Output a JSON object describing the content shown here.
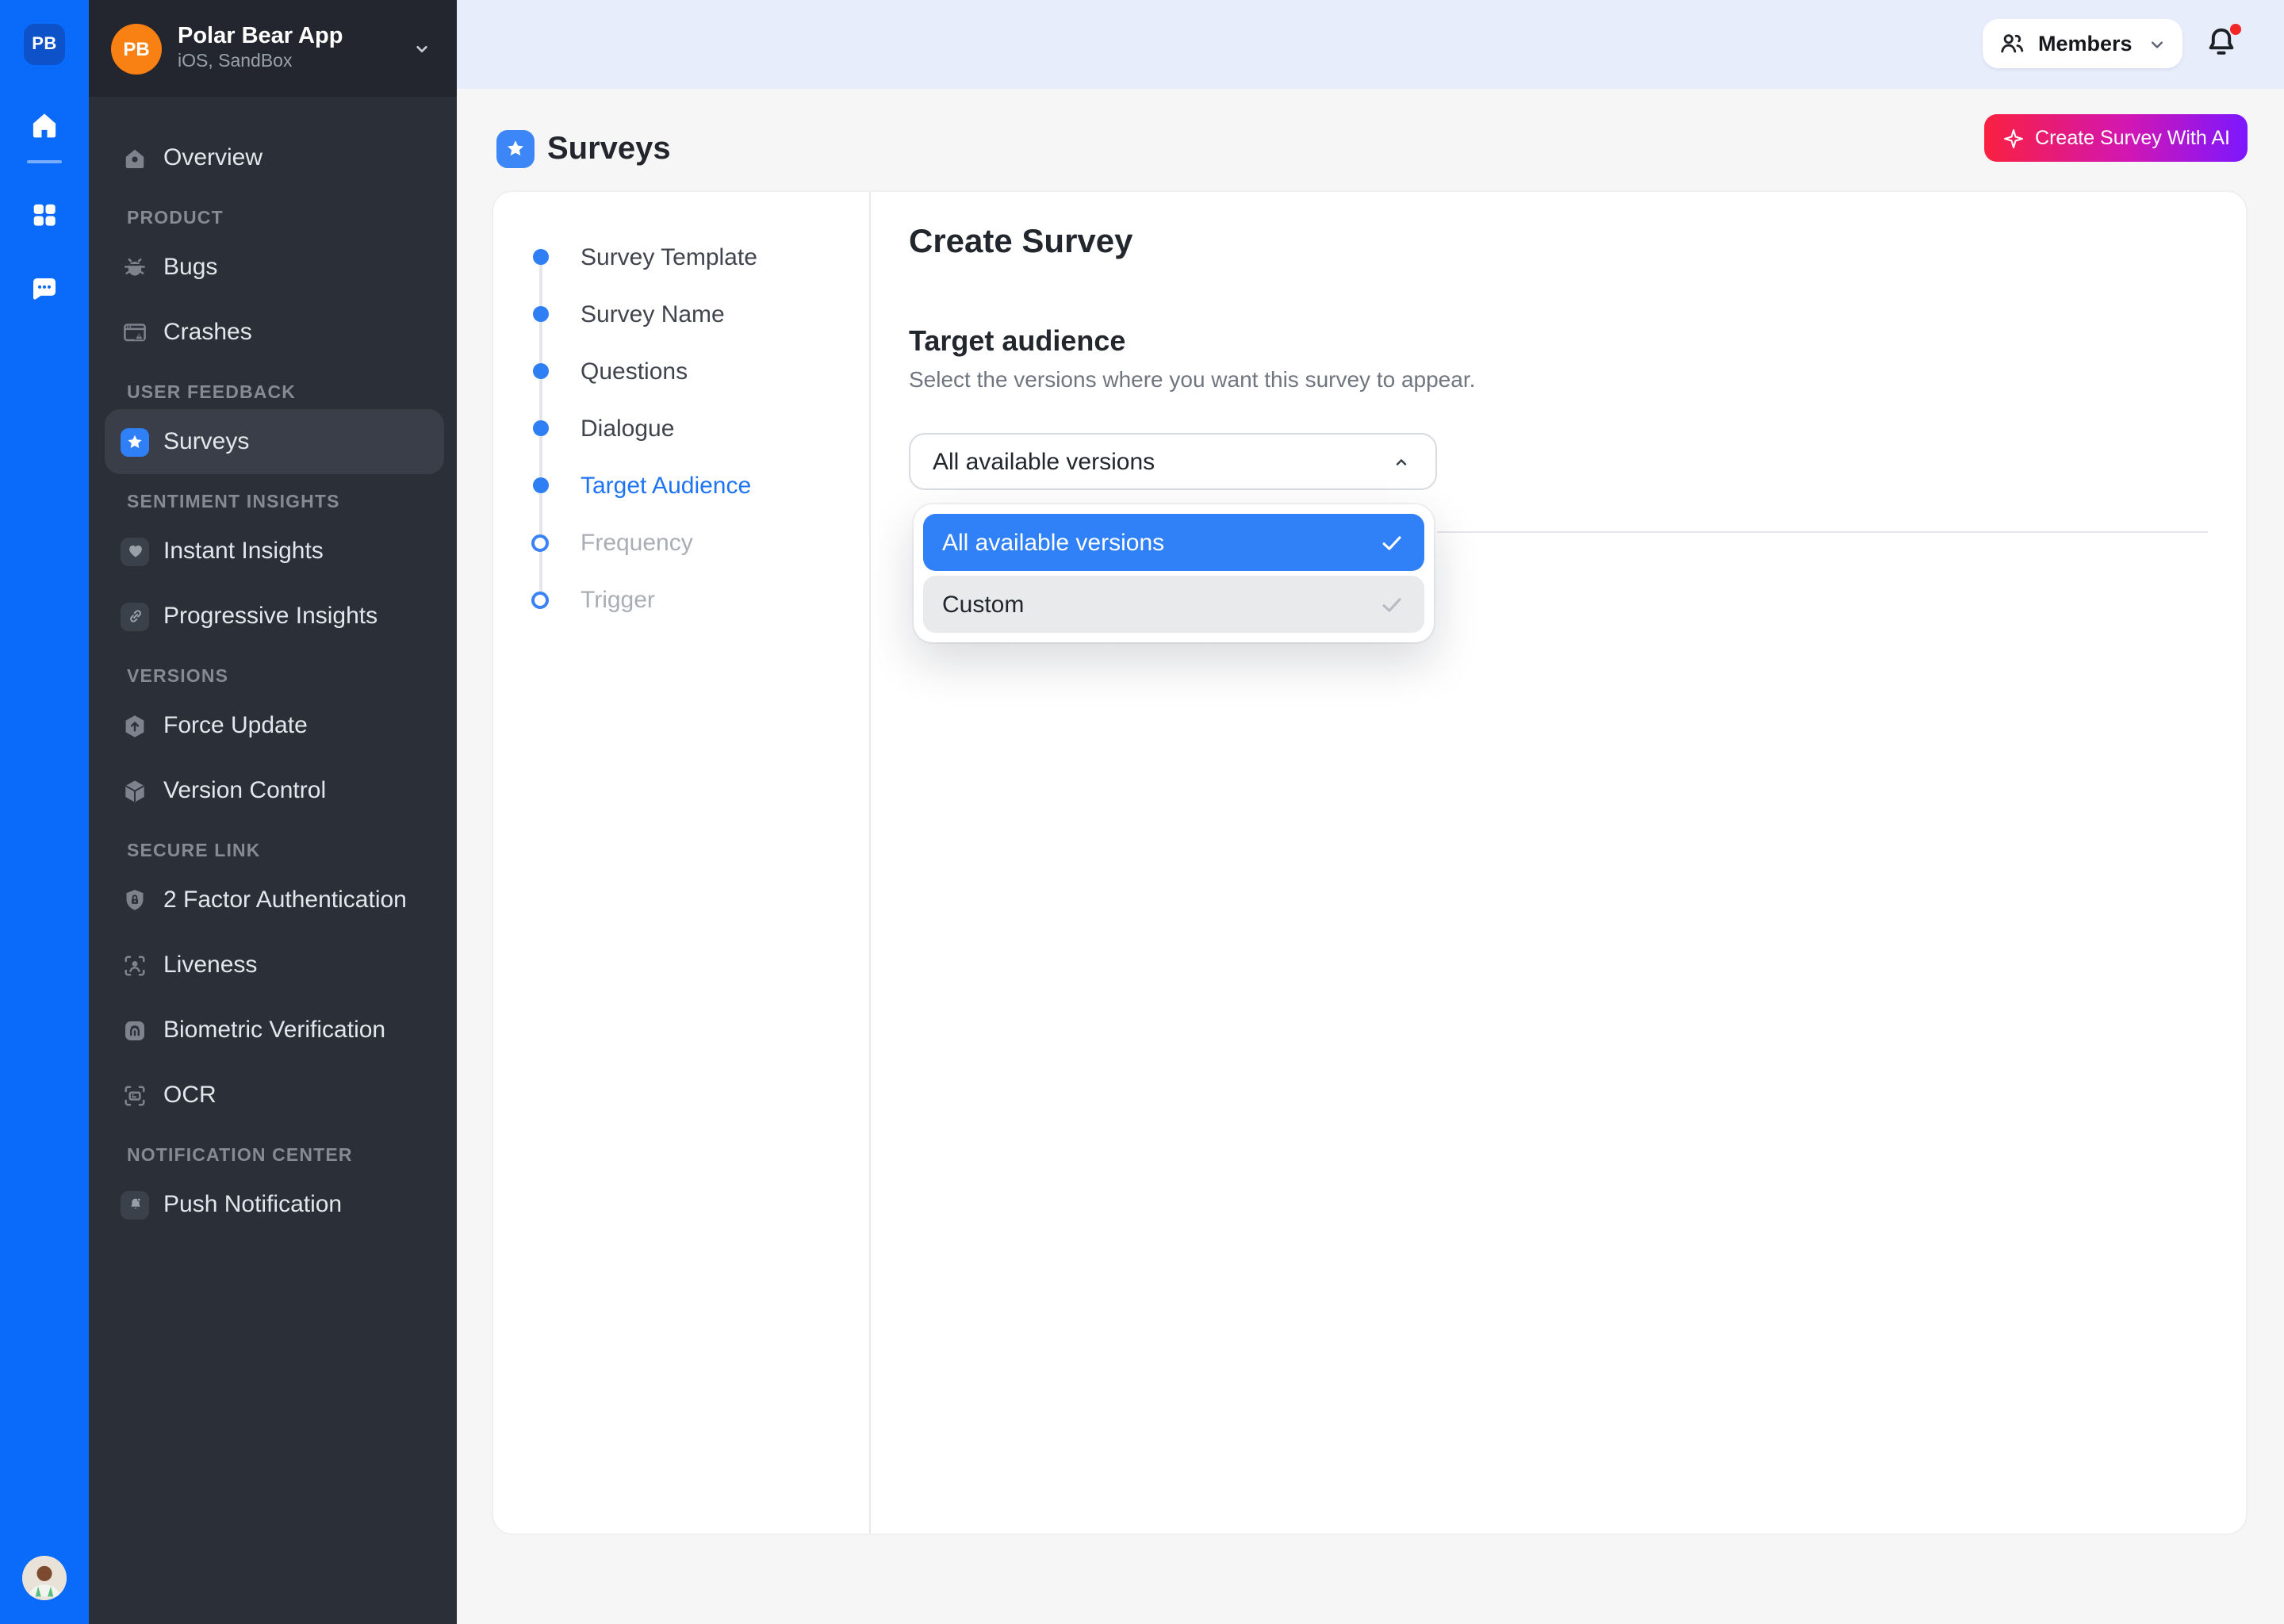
{
  "colors": {
    "rail_blue": "#0a6bfb",
    "accent_blue": "#2f80f7",
    "active_step_blue": "#1f74f4",
    "create_button_gradient_start": "#fa2040",
    "create_button_gradient_end": "#7c17ff",
    "notification_dot_red": "#f42525",
    "app_badge_orange": "#f98012",
    "sidebar_dark": "#2b2f38",
    "topbar_light_blue": "#e7edfb"
  },
  "rail": {
    "logo": "PB",
    "icons": [
      "home-icon",
      "apps-grid-icon",
      "chat-icon"
    ],
    "avatar": "user-avatar"
  },
  "app_switcher": {
    "badge": "PB",
    "name": "Polar Bear App",
    "platform": "iOS, SandBox"
  },
  "sidebar": {
    "sections": [
      {
        "label": "",
        "items": [
          {
            "label": "Overview",
            "icon": "home-overview-icon",
            "selected": false
          }
        ]
      },
      {
        "label": "PRODUCT",
        "items": [
          {
            "label": "Bugs",
            "icon": "bug-icon",
            "selected": false
          },
          {
            "label": "Crashes",
            "icon": "crash-window-icon",
            "selected": false
          }
        ]
      },
      {
        "label": "USER FEEDBACK",
        "items": [
          {
            "label": "Surveys",
            "icon": "star-icon",
            "selected": true
          }
        ]
      },
      {
        "label": "SENTIMENT INSIGHTS",
        "items": [
          {
            "label": "Instant Insights",
            "icon": "heart-icon",
            "selected": false
          },
          {
            "label": "Progressive Insights",
            "icon": "link-icon",
            "selected": false
          }
        ]
      },
      {
        "label": "VERSIONS",
        "items": [
          {
            "label": "Force Update",
            "icon": "hexagon-up-arrow-icon",
            "selected": false
          },
          {
            "label": "Version Control",
            "icon": "cube-icon",
            "selected": false
          }
        ]
      },
      {
        "label": "SECURE LINK",
        "items": [
          {
            "label": "2 Factor Authentication",
            "icon": "shield-lock-icon",
            "selected": false
          },
          {
            "label": "Liveness",
            "icon": "face-scan-icon",
            "selected": false
          },
          {
            "label": "Biometric Verification",
            "icon": "fingerprint-icon",
            "selected": false
          },
          {
            "label": "OCR",
            "icon": "card-scan-icon",
            "selected": false
          }
        ]
      },
      {
        "label": "NOTIFICATION CENTER",
        "items": [
          {
            "label": "Push Notification",
            "icon": "bell-icon",
            "selected": false
          }
        ]
      }
    ]
  },
  "topbar": {
    "members_label": "Members",
    "members_icon": "people-icon",
    "bell_icon": "bell-alert-icon",
    "unread_indicator": true
  },
  "page_header": {
    "title": "Surveys",
    "title_icon": "star-icon",
    "create_button_label": "Create Survey With AI",
    "create_button_icon": "sparkle-icon"
  },
  "stepper": {
    "steps": [
      {
        "label": "Survey Template",
        "state": "done"
      },
      {
        "label": "Survey Name",
        "state": "done"
      },
      {
        "label": "Questions",
        "state": "done"
      },
      {
        "label": "Dialogue",
        "state": "done"
      },
      {
        "label": "Target Audience",
        "state": "active"
      },
      {
        "label": "Frequency",
        "state": "upcoming"
      },
      {
        "label": "Trigger",
        "state": "upcoming"
      }
    ]
  },
  "form": {
    "heading": "Create Survey",
    "section": {
      "title": "Target audience",
      "description": "Select the versions where you want this survey to appear.",
      "dropdown": {
        "value": "All available versions",
        "expanded": true,
        "options": [
          {
            "label": "All available versions",
            "selected": true,
            "highlighted": true
          },
          {
            "label": "Custom",
            "selected": false,
            "highlighted": false
          }
        ]
      }
    }
  }
}
